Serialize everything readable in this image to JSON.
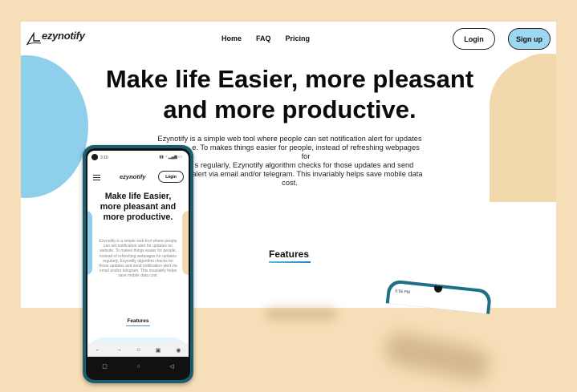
{
  "site": {
    "logo_text": "ezynotify",
    "nav": [
      "Home",
      "FAQ",
      "Pricing"
    ],
    "login_label": "Login",
    "signup_label": "Sign up",
    "hero_title": "Make life Easier, more pleasant and more productive.",
    "hero_desc_lines": [
      "Ezynotify is a simple web tool where people can set notification alert for updates",
      "e. To makes things easier for people, instead of refreshing webpages for",
      "s regularly, Ezynotify algorithm checks for those updates and send",
      "alert via email and/or telegram. This invariably helps save mobile data",
      "cost."
    ],
    "features_heading": "Features"
  },
  "mobile": {
    "status_time": "3:10",
    "logo_text": "ezynotify",
    "login_label": "Login",
    "hero_title": "Make life Easier, more pleasant and more productive.",
    "hero_desc": "Ezynotify is a simple web tool where people can set notification alert for updates on website. To makes things easier for people, instead of refreshing webpages for updates regularly, Ezynotify algorithm checks for those updates and send notification alert via email and/or telegram. This invariably helps save mobile data cost.",
    "features_heading": "Features"
  },
  "second_phone": {
    "status_time": "5:56 PM"
  },
  "colors": {
    "accent_blue": "#8ecfec",
    "accent_peach": "#f2d9ad",
    "background": "#f6dfb8"
  }
}
